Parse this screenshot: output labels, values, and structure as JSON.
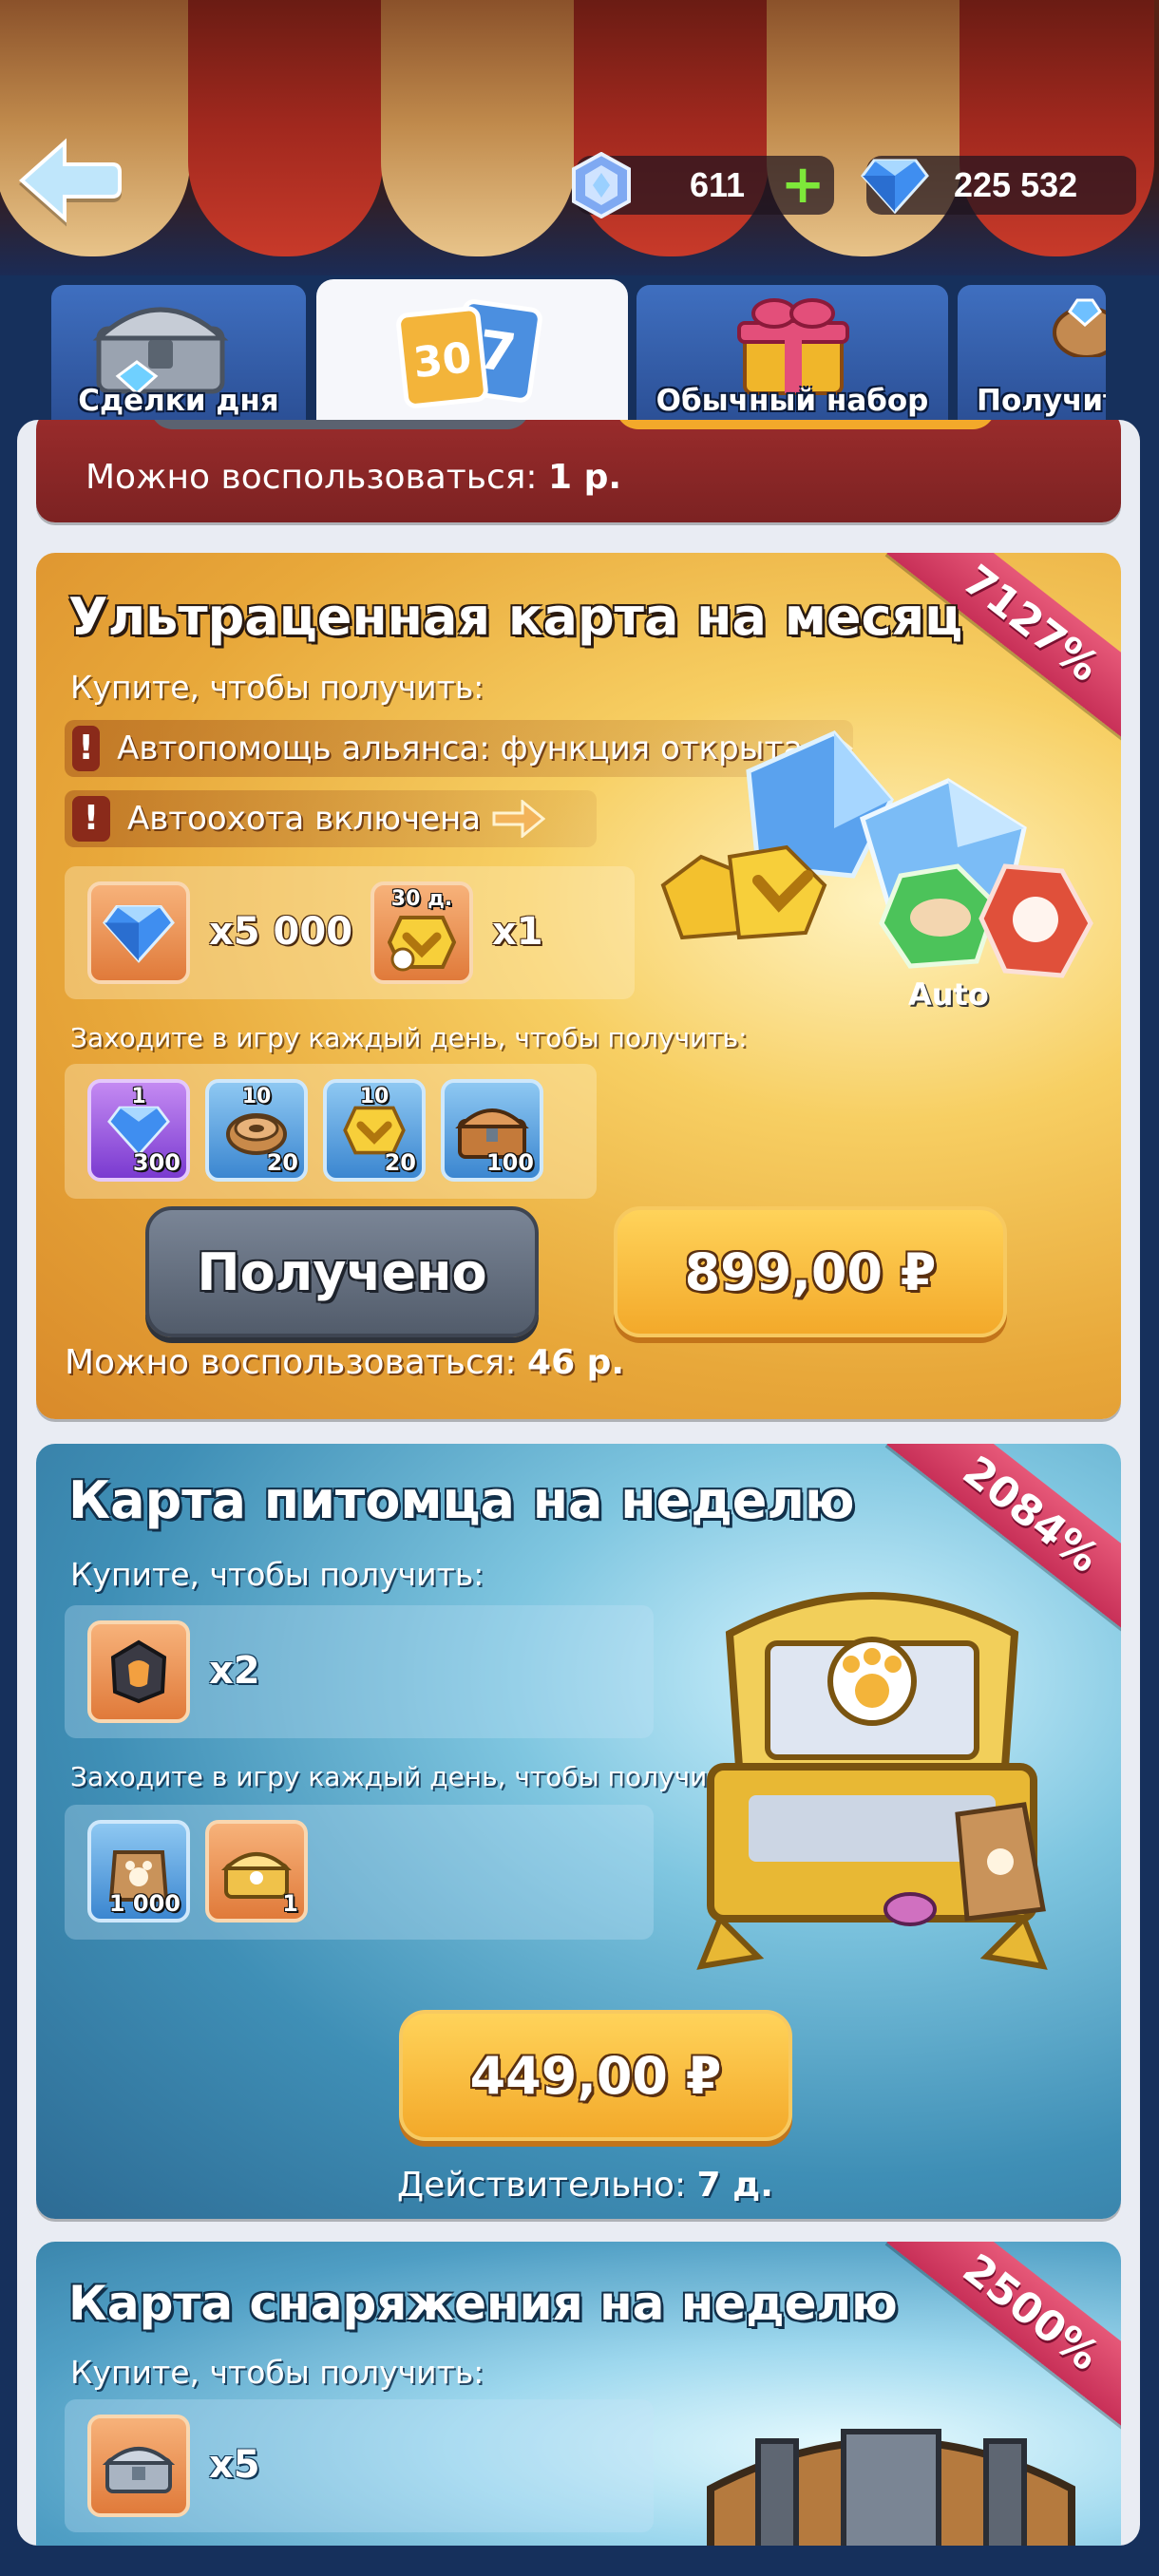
{
  "header": {
    "energy_value": "611",
    "gems_value": "225 532"
  },
  "tabs": [
    {
      "label": "Сделки дня"
    },
    {
      "label": ""
    },
    {
      "label": "Обычный набор"
    },
    {
      "label": "Получит"
    }
  ],
  "prev_card": {
    "usage_label": "Можно воспользоваться:",
    "usage_value": "1 р."
  },
  "monthly_card": {
    "title": "Ультраценная карта на месяц",
    "badge": "7127%",
    "buy_label": "Купите, чтобы получить:",
    "features": [
      "Автопомощь альянса: функция открыта",
      "Автоохота включена"
    ],
    "buy_rewards": [
      {
        "icon": "gem-icon",
        "mult": "x5 000"
      },
      {
        "icon": "speedup-30d-icon",
        "top": "30 д.",
        "mult": "x1"
      }
    ],
    "daily_label": "Заходите в игру каждый день, чтобы получить:",
    "daily_rewards": [
      {
        "icon": "gem-icon",
        "top": "1",
        "count": "300"
      },
      {
        "icon": "reel-icon",
        "top": "10",
        "count": "20"
      },
      {
        "icon": "speedup-icon",
        "top": "10",
        "count": "20"
      },
      {
        "icon": "chest-icon",
        "count": "100"
      }
    ],
    "auto_label": "Auto",
    "claimed_button": "Получено",
    "price_button": "899,00 ₽",
    "usage_label": "Можно воспользоваться:",
    "usage_value": "46 р."
  },
  "pet_card": {
    "title": "Карта питомца на неделю",
    "badge": "2084%",
    "buy_label": "Купите, чтобы получить:",
    "buy_rewards": [
      {
        "icon": "pet-stone-icon",
        "mult": "x2"
      }
    ],
    "daily_label": "Заходите в игру каждый день, чтобы получить:",
    "daily_rewards": [
      {
        "icon": "pet-food-bag-icon",
        "count": "1 000"
      },
      {
        "icon": "pet-chest-icon",
        "count": "1"
      }
    ],
    "price_button": "449,00 ₽",
    "valid_label": "Действительно:",
    "valid_value": "7 д."
  },
  "gear_card": {
    "title": "Карта снаряжения на неделю",
    "badge": "2500%",
    "buy_label": "Купите, чтобы получить:",
    "buy_rewards": [
      {
        "icon": "gear-chest-icon",
        "mult": "x5"
      }
    ]
  },
  "colors": {
    "gold_button": "#f3a92a",
    "gray_button": "#525c6b",
    "ribbon": "#d63d62",
    "plus": "#7ee83a"
  }
}
